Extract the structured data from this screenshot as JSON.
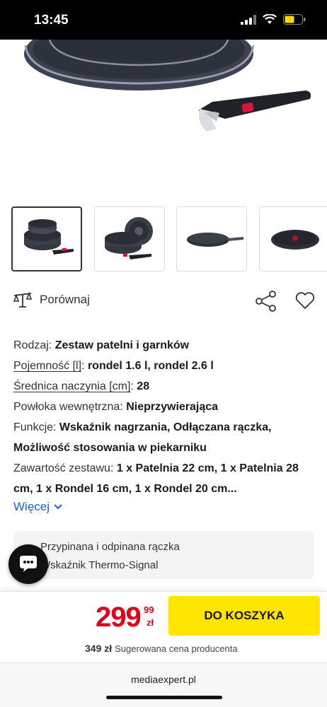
{
  "status_bar": {
    "time": "13:45"
  },
  "actions": {
    "compare_label": "Porównaj"
  },
  "specs": [
    {
      "label": "Rodzaj:",
      "value": "Zestaw patelni i garnków"
    },
    {
      "label": "Pojemność [l]",
      "value": "rondel 1.6 l, rondel 2.6 l"
    },
    {
      "label": "Średnica naczynia [cm]",
      "value": "28"
    },
    {
      "label": "Powłoka wewnętrzna:",
      "value": "Nieprzywierająca"
    },
    {
      "label": "Funkcje:",
      "value": "Wskaźnik nagrzania, Odłączana rączka, Możliwość stosowania w piekarniku"
    },
    {
      "label": "Zawartość zestawu:",
      "value": "1 x Patelnia 22 cm, 1 x Patelnia 28 cm, 1 x Rondel 16 cm, 1 x Rondel 20 cm..."
    }
  ],
  "more_label": "Więcej",
  "features": [
    "Przypinana i odpinana rączka",
    "Wskaźnik Thermo-Signal"
  ],
  "bottom_bar": {
    "price_main": "299",
    "price_cents": "99",
    "price_currency": "zł",
    "cart_button": "DO KOSZYKA",
    "old_price": "349 zł",
    "old_price_note": "Sugerowana cena producenta"
  },
  "browser": {
    "url": "mediaexpert.pl"
  },
  "colors": {
    "accent_red": "#e3001b",
    "cart_yellow": "#ffe500",
    "link_blue": "#1a5fe0"
  }
}
